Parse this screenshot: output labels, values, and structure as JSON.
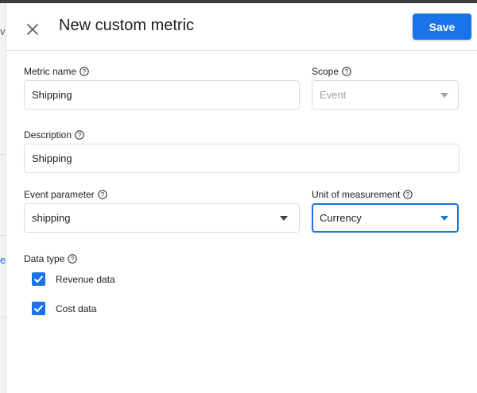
{
  "dialog": {
    "title": "New custom metric",
    "save_label": "Save"
  },
  "fields": {
    "metric_name": {
      "label": "Metric name",
      "value": "Shipping"
    },
    "scope": {
      "label": "Scope",
      "value": "Event"
    },
    "description": {
      "label": "Description",
      "value": "Shipping"
    },
    "event_parameter": {
      "label": "Event parameter",
      "value": "shipping"
    },
    "unit_of_measurement": {
      "label": "Unit of measurement",
      "value": "Currency"
    }
  },
  "data_type": {
    "label": "Data type",
    "options": [
      {
        "label": "Revenue data",
        "checked": true
      },
      {
        "label": "Cost data",
        "checked": true
      }
    ]
  },
  "background": {
    "glyph_a": "v",
    "glyph_b": "e"
  },
  "colors": {
    "accent": "#1a73e8",
    "border": "#dadce0",
    "disabled_text": "#9aa0a6"
  },
  "icons": {
    "close": "close-icon",
    "help": "help-circle-icon",
    "dropdown": "caret-down-icon",
    "check": "check-icon"
  }
}
